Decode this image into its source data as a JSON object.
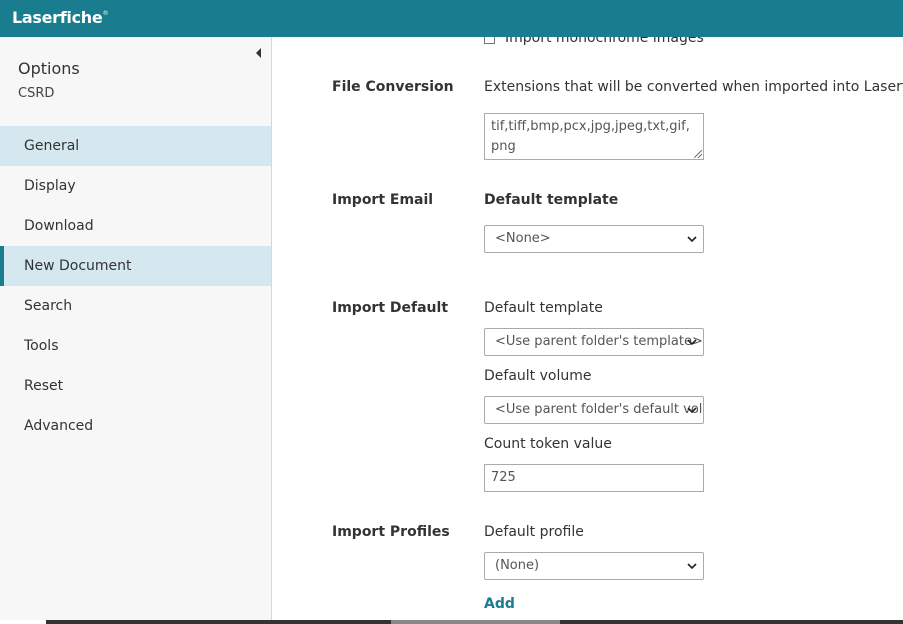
{
  "app": {
    "logo_text": "Laserfiche",
    "logo_mark": "®",
    "brand_color": "#1a7d8f"
  },
  "sidebar": {
    "title": "Options",
    "subtitle": "CSRD",
    "items": [
      {
        "label": "General"
      },
      {
        "label": "Display"
      },
      {
        "label": "Download"
      },
      {
        "label": "New Document"
      },
      {
        "label": "Search"
      },
      {
        "label": "Tools"
      },
      {
        "label": "Reset"
      },
      {
        "label": "Advanced"
      }
    ]
  },
  "main": {
    "monochrome_checkbox": {
      "label": "Import monochrome images",
      "checked": false
    },
    "file_conversion": {
      "label": "File Conversion",
      "description": "Extensions that will be converted when imported into Laserfiche",
      "extensions": "tif,tiff,bmp,pcx,jpg,jpeg,txt,gif,png"
    },
    "import_email": {
      "label": "Import Email",
      "template_label": "Default template",
      "template_value": "<None>"
    },
    "import_default": {
      "label": "Import Default",
      "template_label": "Default template",
      "template_value": "<Use parent folder's template>",
      "volume_label": "Default volume",
      "volume_value": "<Use parent folder's default volume>",
      "count_token_label": "Count token value",
      "count_token_value": "725"
    },
    "import_profiles": {
      "label": "Import Profiles",
      "profile_label": "Default profile",
      "profile_value": "(None)",
      "add_label": "Add"
    }
  }
}
